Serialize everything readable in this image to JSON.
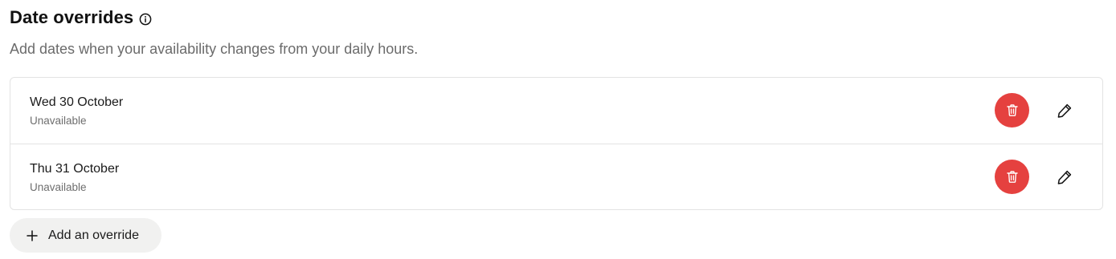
{
  "section": {
    "title": "Date overrides",
    "subtitle": "Add dates when your availability changes from your daily hours."
  },
  "overrides": [
    {
      "date": "Wed 30 October",
      "status": "Unavailable"
    },
    {
      "date": "Thu 31 October",
      "status": "Unavailable"
    }
  ],
  "actions": {
    "add_label": "Add an override"
  },
  "icons": {
    "info": "info-circle-icon",
    "delete": "trash-icon",
    "edit": "pencil-icon",
    "add": "plus-icon"
  },
  "colors": {
    "delete_button": "#e5413f",
    "add_button_bg": "#f1f1f0",
    "border": "#e3e3e3",
    "muted_text": "#6b6b6b"
  }
}
